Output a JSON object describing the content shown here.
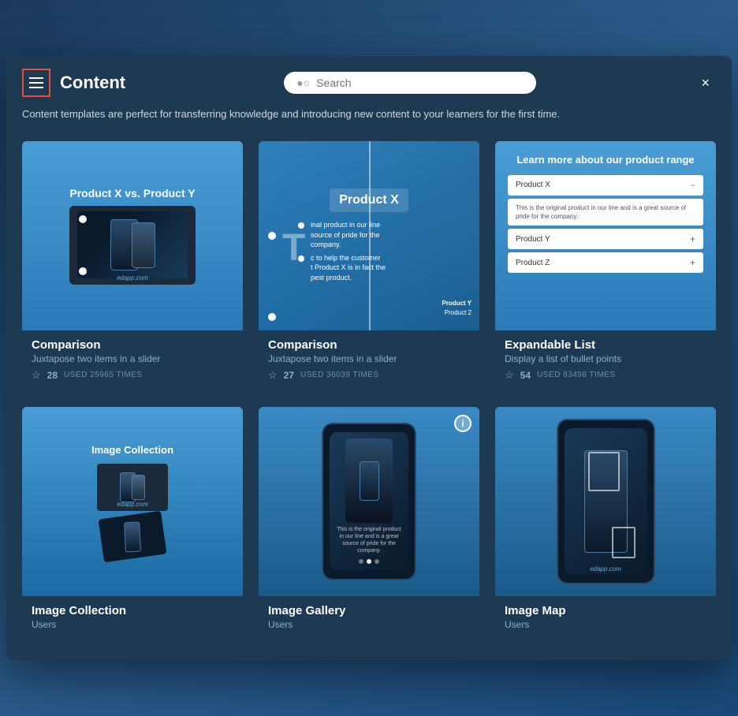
{
  "modal": {
    "title": "Content",
    "close_label": "×",
    "description": "Content templates are perfect for transferring knowledge and introducing new content to your learners for the first time.",
    "search_placeholder": "Search"
  },
  "menu_button": {
    "aria_label": "Menu"
  },
  "cards": [
    {
      "id": "card-1",
      "preview_title": "Product X vs. Product Y",
      "name": "Comparison",
      "description": "Juxtapose two items in a slider",
      "stars": "28",
      "used": "USED 25965 TIMES"
    },
    {
      "id": "card-2",
      "preview_title": "Product X",
      "name": "Comparison",
      "description": "Juxtapose two items in a slider",
      "stars": "27",
      "used": "USED 36039 TIMES",
      "text_lines": [
        "inal product in our line",
        "source of pride for the",
        "company.",
        "c to help the customer",
        "t Product X is in fact the",
        "pest product."
      ]
    },
    {
      "id": "card-3",
      "preview_title": "Learn more about our product range",
      "name": "Expandable List",
      "description": "Display a list of bullet points",
      "stars": "54",
      "used": "USED 83498 TIMES",
      "items": [
        {
          "label": "Product X",
          "expanded": true,
          "content": "This is the original product in our line and is a great source of pride for the company."
        },
        {
          "label": "Product Y",
          "expanded": false
        },
        {
          "label": "Product Z",
          "expanded": false
        }
      ]
    },
    {
      "id": "card-4",
      "preview_title": "Image Collection",
      "name": "Image Collection",
      "description": "Users",
      "stars": "",
      "used": ""
    },
    {
      "id": "card-5",
      "preview_title": "Image Gallery",
      "name": "Image Gallery",
      "description": "Users",
      "phone_text": "This is the original product in our line and is a great source of pride for the company.",
      "stars": "",
      "used": ""
    },
    {
      "id": "card-6",
      "preview_title": "Image Map",
      "name": "Image Map",
      "description": "Users",
      "stars": "",
      "used": ""
    }
  ],
  "product_y_label": "Product Y",
  "product_2_label": "Product 2"
}
